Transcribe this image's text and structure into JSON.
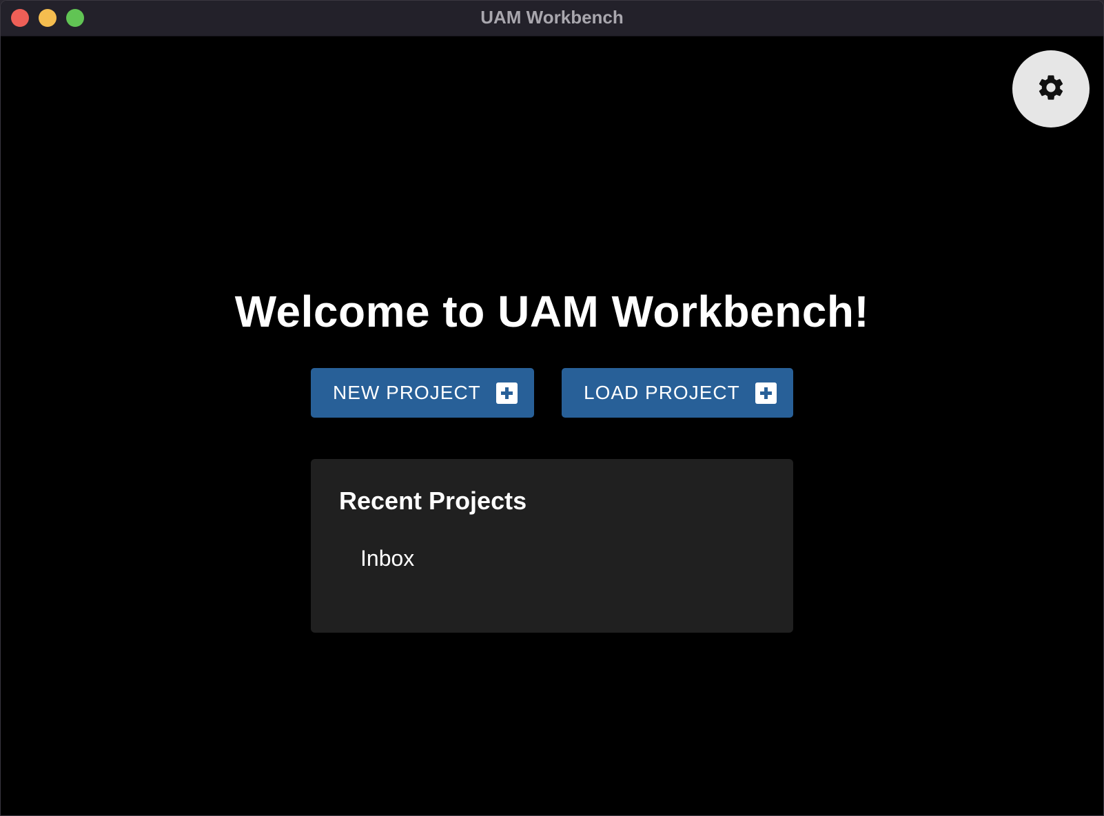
{
  "window": {
    "title": "UAM Workbench",
    "controls": [
      "close",
      "minimize",
      "zoom"
    ]
  },
  "settings": {
    "icon": "gear-icon"
  },
  "welcome": {
    "heading": "Welcome to UAM Workbench!"
  },
  "actions": {
    "new_project_label": "NEW PROJECT",
    "load_project_label": "LOAD PROJECT",
    "icon": "plus-square-icon"
  },
  "recent": {
    "title": "Recent Projects",
    "items": [
      {
        "label": "Inbox"
      }
    ]
  },
  "colors": {
    "background": "#000000",
    "titlebar": "#23212a",
    "button": "#286098",
    "panel": "#202020",
    "settings_button": "#e6e6e6"
  }
}
